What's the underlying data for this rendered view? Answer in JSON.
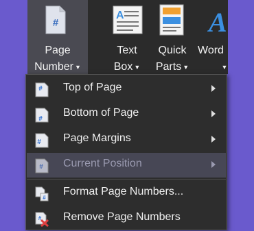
{
  "ribbon": {
    "page_number": {
      "line1": "Page",
      "line2": "Number",
      "icon": "page-number-icon"
    },
    "text_box": {
      "line1": "Text",
      "line2": "Box",
      "icon": "text-box-icon"
    },
    "quick_parts": {
      "line1": "Quick",
      "line2": "Parts",
      "icon": "quick-parts-icon"
    },
    "wordart": {
      "line1": "Word",
      "icon": "wordart-icon"
    }
  },
  "menu": {
    "items": [
      {
        "label": "Top of Page",
        "submenu": true,
        "icon": "page-hash-top-icon"
      },
      {
        "label": "Bottom of Page",
        "submenu": true,
        "icon": "page-hash-bottom-icon"
      },
      {
        "label": "Page Margins",
        "submenu": true,
        "icon": "page-hash-margin-icon"
      },
      {
        "label": "Current Position",
        "submenu": true,
        "icon": "page-hash-current-icon",
        "state": "hovered"
      },
      {
        "label": "Format Page Numbers...",
        "submenu": false,
        "icon": "format-page-numbers-icon"
      },
      {
        "label": "Remove Page Numbers",
        "submenu": false,
        "icon": "remove-page-numbers-icon"
      }
    ]
  },
  "colors": {
    "background": "#6a5acd",
    "ribbon": "#2b2b2b",
    "menu": "#2d2d2d",
    "hover": "#474755",
    "accent_blue": "#3b8fe0",
    "remove_red": "#e04040"
  }
}
